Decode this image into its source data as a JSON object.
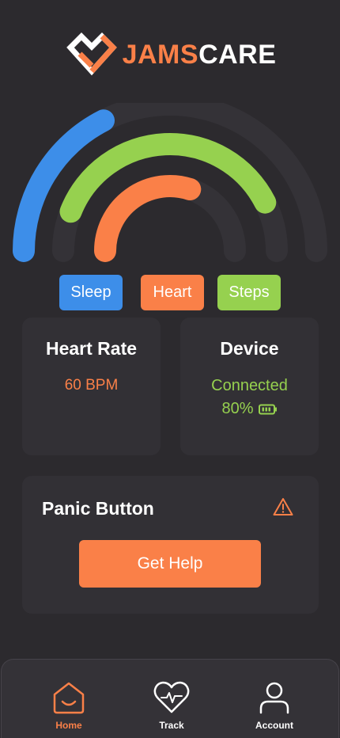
{
  "brand": {
    "name_part1": "JAMS",
    "name_part2": "CARE",
    "accent_color": "#fa8048"
  },
  "rings": {
    "sleep": {
      "color": "#3d8ee9",
      "level": 0.35
    },
    "steps": {
      "color": "#96d14f",
      "level": 0.85
    },
    "heart": {
      "color": "#fa8048",
      "level": 0.6
    },
    "track_color": "#343237"
  },
  "chips": {
    "sleep": "Sleep",
    "heart": "Heart",
    "steps": "Steps"
  },
  "heart_rate": {
    "title": "Heart Rate",
    "value": "60 BPM"
  },
  "device": {
    "title": "Device",
    "status": "Connected",
    "battery": "80%",
    "battery_icon": "battery-icon"
  },
  "panic": {
    "title": "Panic Button",
    "button_label": "Get Help",
    "icon": "warning-icon"
  },
  "nav": {
    "items": [
      {
        "label": "Home",
        "icon": "home-icon",
        "active": true
      },
      {
        "label": "Track",
        "icon": "heart-pulse-icon",
        "active": false
      },
      {
        "label": "Account",
        "icon": "user-icon",
        "active": false
      }
    ]
  }
}
